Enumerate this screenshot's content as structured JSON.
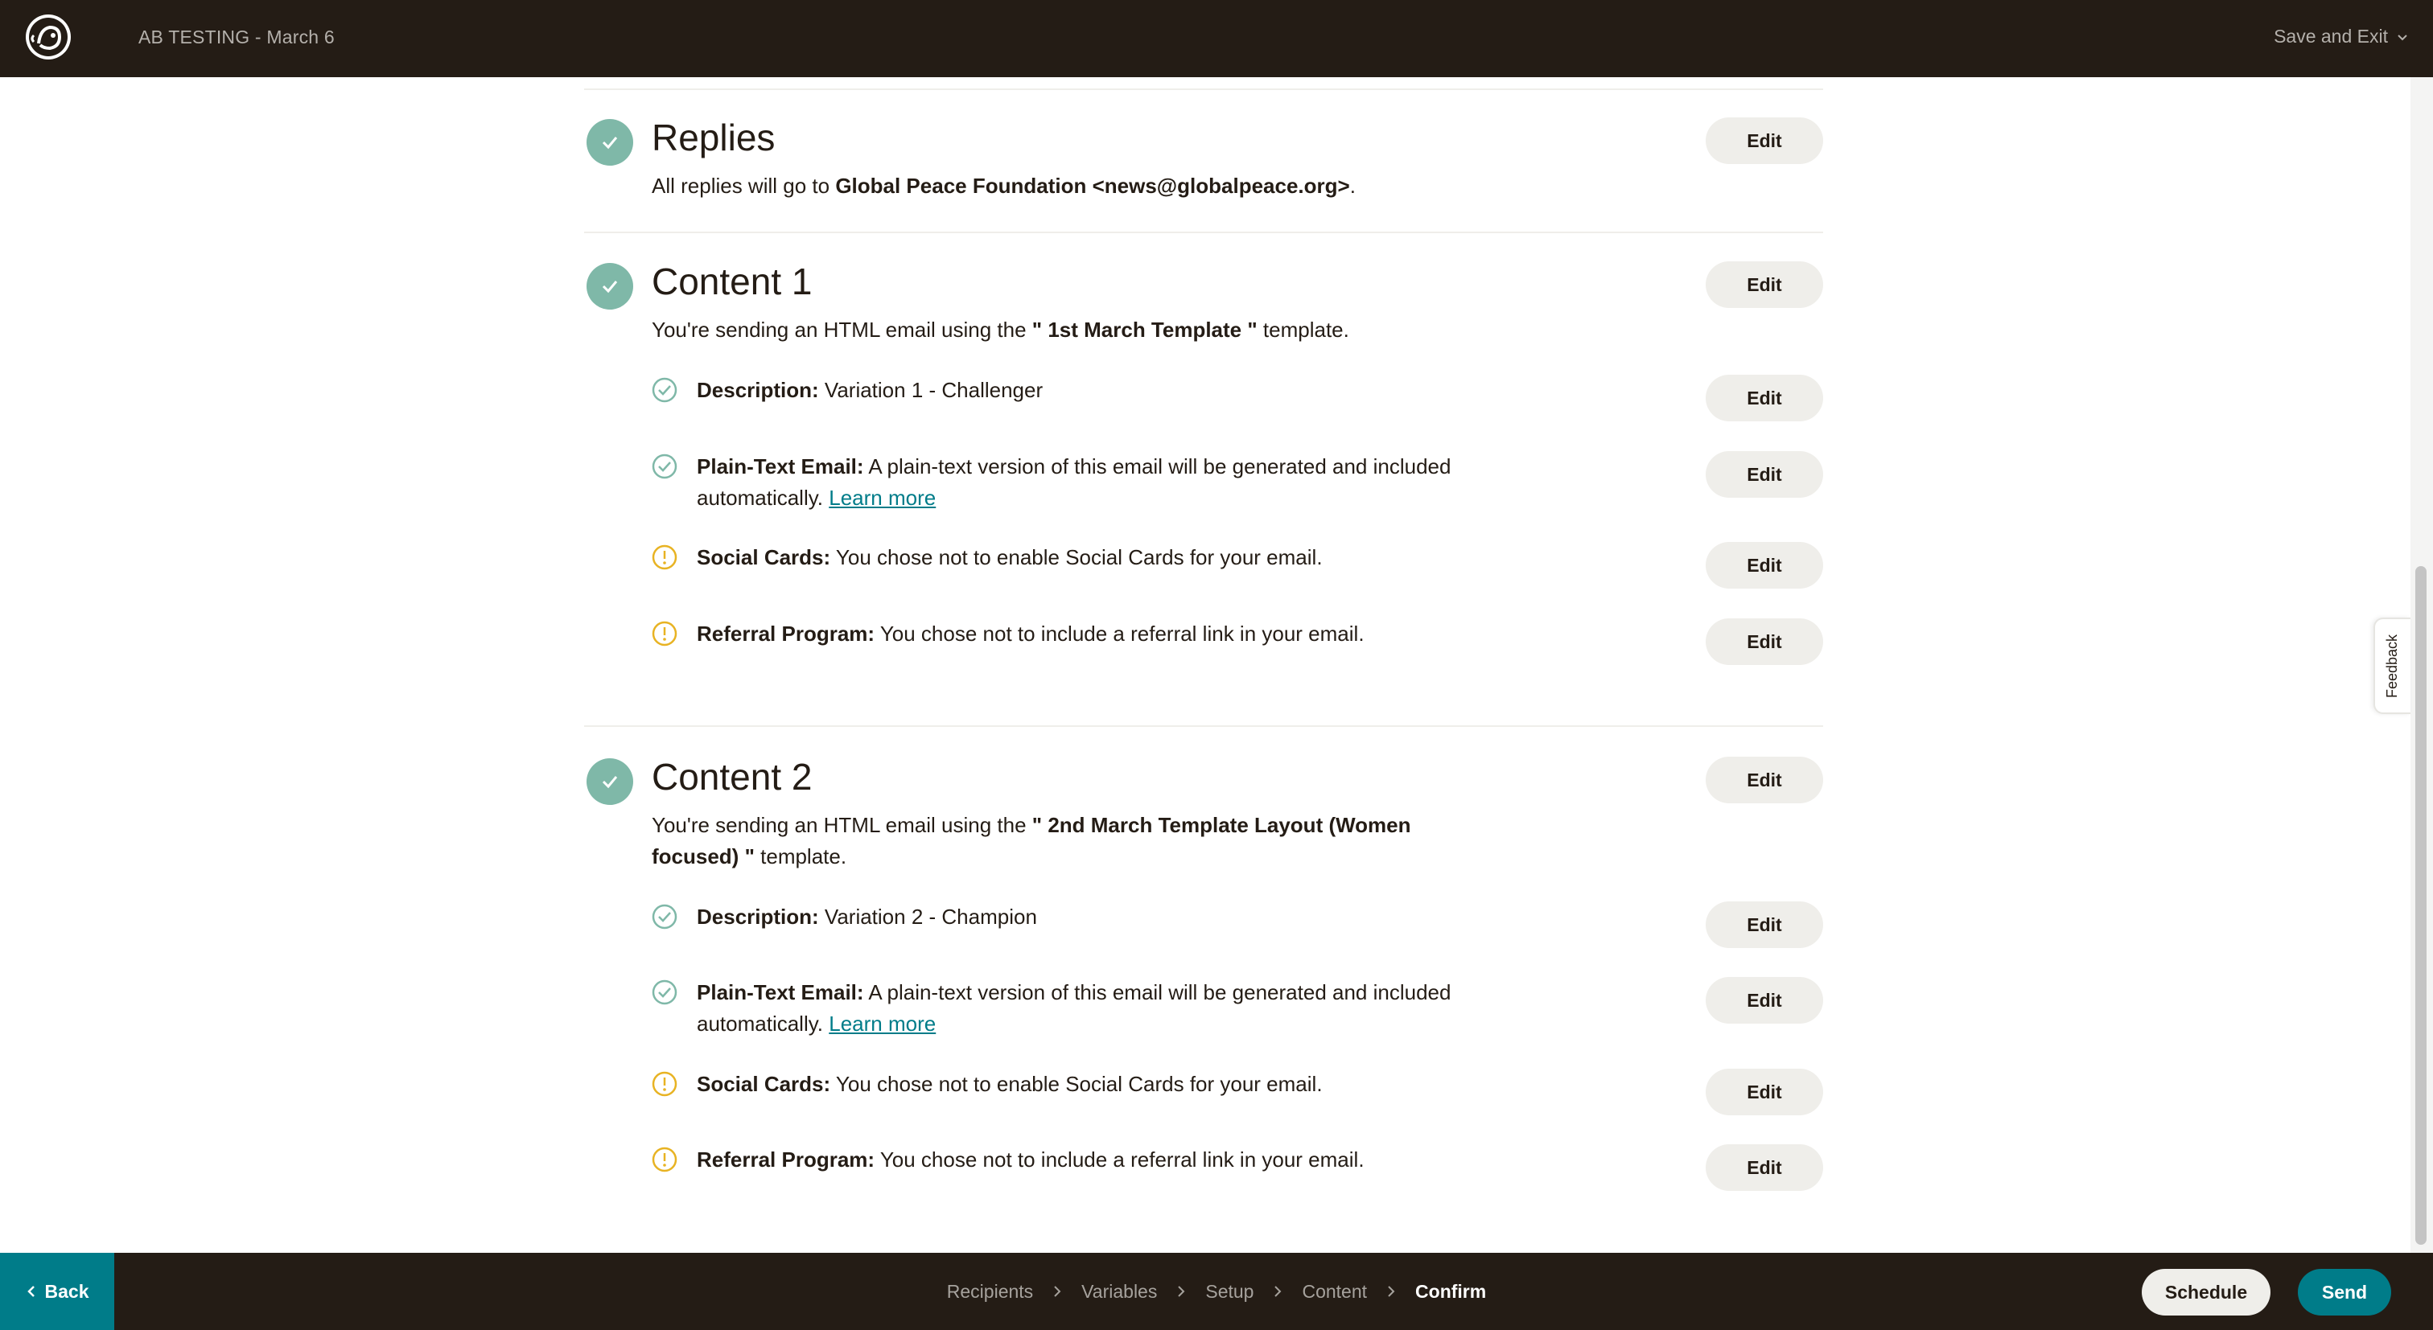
{
  "header": {
    "campaign_title": "AB TESTING - March 6",
    "save_exit_label": "Save and Exit"
  },
  "sections": {
    "replies": {
      "title": "Replies",
      "text_prefix": "All replies will go to ",
      "text_bold": "Global Peace Foundation <news@globalpeace.org>",
      "text_suffix": ".",
      "edit_label": "Edit"
    },
    "content1": {
      "title": "Content 1",
      "text_prefix": "You're sending an HTML email using the ",
      "text_bold": "\" 1st March Template \"",
      "text_suffix": " template.",
      "edit_label": "Edit",
      "items": [
        {
          "label": "Description:",
          "text": " Variation 1 - Challenger",
          "status": "check",
          "edit_label": "Edit"
        },
        {
          "label": "Plain-Text Email:",
          "text": " A plain-text version of this email will be generated and included automatically. ",
          "link": "Learn more",
          "status": "check",
          "edit_label": "Edit"
        },
        {
          "label": "Social Cards:",
          "text": " You chose not to enable Social Cards for your email.",
          "status": "warning",
          "edit_label": "Edit"
        },
        {
          "label": "Referral Program:",
          "text": " You chose not to include a referral link in your email.",
          "status": "warning",
          "edit_label": "Edit"
        }
      ]
    },
    "content2": {
      "title": "Content 2",
      "text_prefix": "You're sending an HTML email using the ",
      "text_bold": "\" 2nd March Template Layout (Women focused) \"",
      "text_suffix": " template.",
      "edit_label": "Edit",
      "items": [
        {
          "label": "Description:",
          "text": " Variation 2 - Champion",
          "status": "check",
          "edit_label": "Edit"
        },
        {
          "label": "Plain-Text Email:",
          "text": " A plain-text version of this email will be generated and included automatically. ",
          "link": "Learn more",
          "status": "check",
          "edit_label": "Edit"
        },
        {
          "label": "Social Cards:",
          "text": " You chose not to enable Social Cards for your email.",
          "status": "warning",
          "edit_label": "Edit"
        },
        {
          "label": "Referral Program:",
          "text": " You chose not to include a referral link in your email.",
          "status": "warning",
          "edit_label": "Edit"
        }
      ]
    }
  },
  "feedback_label": "Feedback",
  "footer": {
    "back_label": "Back",
    "breadcrumbs": [
      "Recipients",
      "Variables",
      "Setup",
      "Content",
      "Confirm"
    ],
    "schedule_label": "Schedule",
    "send_label": "Send"
  },
  "colors": {
    "dark": "#241c15",
    "teal": "#007c89",
    "check_green": "#7fb8a8",
    "warning_yellow": "#e8b323",
    "button_bg": "#efeeea"
  },
  "icons": {
    "logo": "freddie-logo-icon",
    "section_check": "check-circle-icon",
    "item_check": "check-outline-icon",
    "item_warning": "warning-outline-icon"
  }
}
